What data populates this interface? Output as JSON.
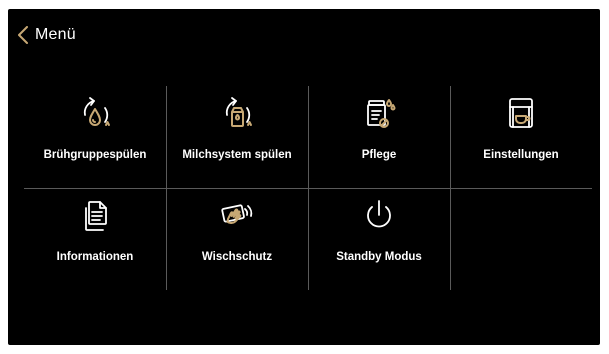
{
  "header": {
    "back_label": "Menü"
  },
  "menu": {
    "items": [
      {
        "label": "Brühgruppespülen",
        "icon": "brew-group-rinse-icon"
      },
      {
        "label": "Milchsystem spülen",
        "icon": "milk-system-rinse-icon"
      },
      {
        "label": "Pflege",
        "icon": "care-icon"
      },
      {
        "label": "Einstellungen",
        "icon": "settings-machine-icon"
      },
      {
        "label": "Informationen",
        "icon": "documents-icon"
      },
      {
        "label": "Wischschutz",
        "icon": "wipe-protection-icon"
      },
      {
        "label": "Standby Modus",
        "icon": "power-icon"
      }
    ]
  },
  "colors": {
    "background": "#000000",
    "accent": "#c7a874",
    "text": "#ffffff",
    "divider": "#5a5a5a"
  }
}
